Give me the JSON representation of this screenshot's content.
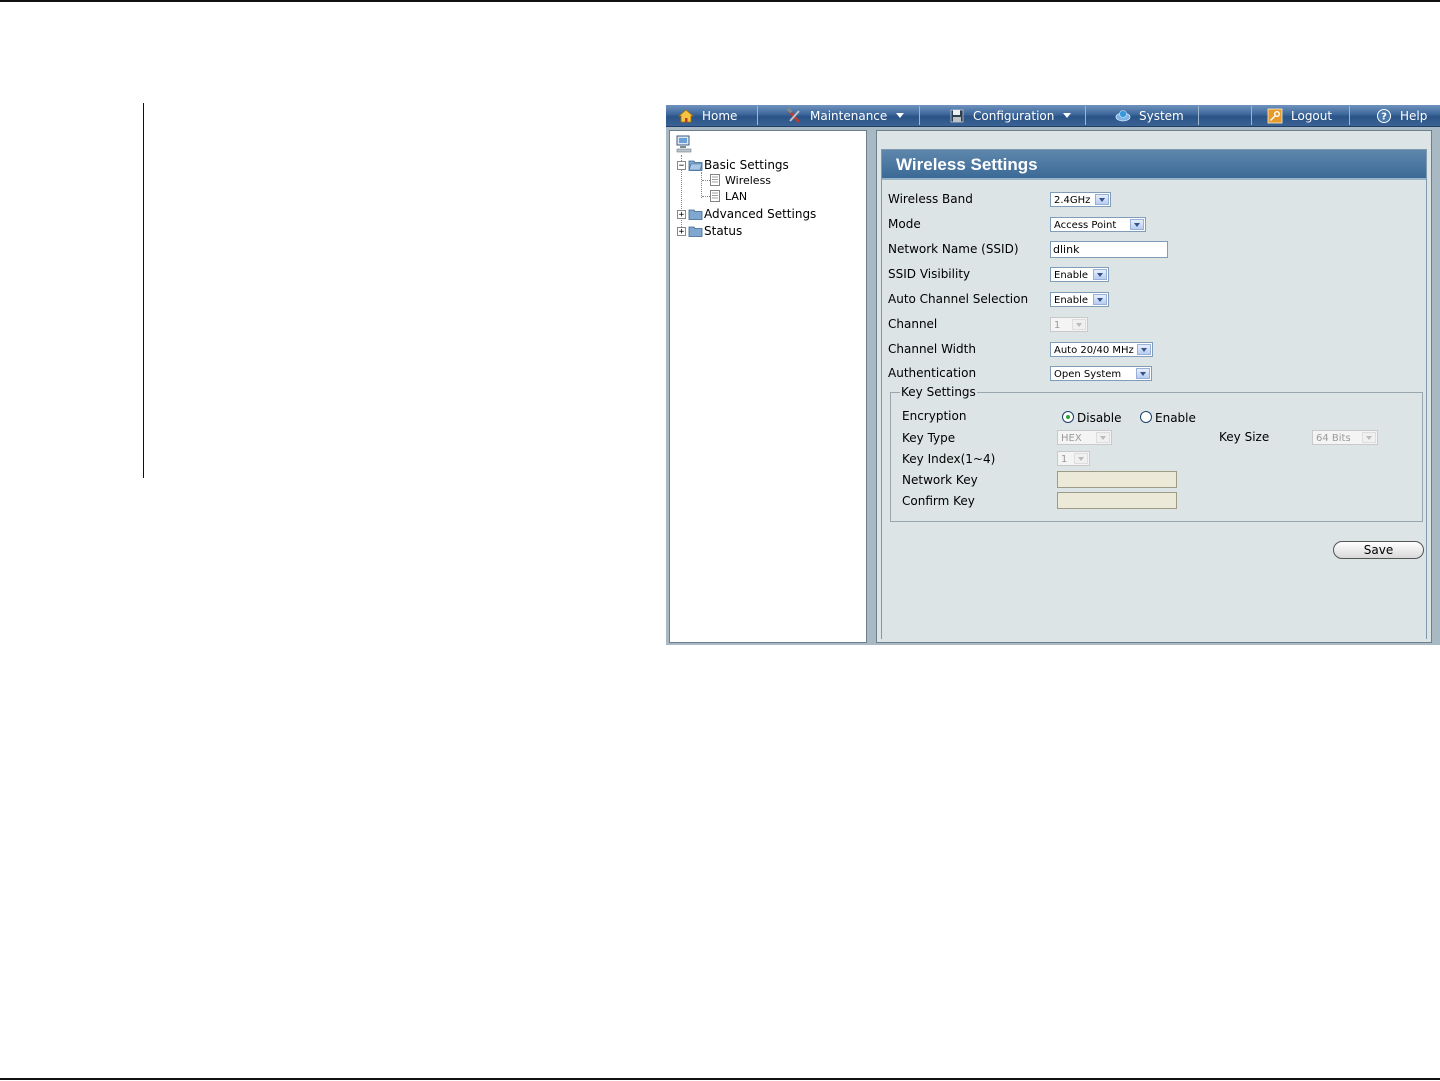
{
  "nav": {
    "home": "Home",
    "maintenance": "Maintenance",
    "configuration": "Configuration",
    "system": "System",
    "logout": "Logout",
    "help": "Help"
  },
  "tree": {
    "basic_settings": "Basic Settings",
    "wireless": "Wireless",
    "lan": "LAN",
    "advanced_settings": "Advanced Settings",
    "status": "Status"
  },
  "panel": {
    "title": "Wireless Settings"
  },
  "form": {
    "wireless_band": {
      "label": "Wireless Band",
      "value": "2.4GHz"
    },
    "mode": {
      "label": "Mode",
      "value": "Access Point"
    },
    "ssid": {
      "label": "Network Name (SSID)",
      "value": "dlink"
    },
    "ssid_visibility": {
      "label": "SSID Visibility",
      "value": "Enable"
    },
    "auto_channel": {
      "label": "Auto Channel Selection",
      "value": "Enable"
    },
    "channel": {
      "label": "Channel",
      "value": "1"
    },
    "channel_width": {
      "label": "Channel Width",
      "value": "Auto 20/40 MHz"
    },
    "authentication": {
      "label": "Authentication",
      "value": "Open System"
    }
  },
  "key_settings": {
    "legend": "Key Settings",
    "encryption_label": "Encryption",
    "disable_label": "Disable",
    "enable_label": "Enable",
    "encryption_selected": "Disable",
    "key_type_label": "Key Type",
    "key_type_value": "HEX",
    "key_size_label": "Key Size",
    "key_size_value": "64 Bits",
    "key_index_label": "Key Index(1~4)",
    "key_index_value": "1",
    "network_key_label": "Network Key",
    "confirm_key_label": "Confirm Key"
  },
  "actions": {
    "save": "Save"
  },
  "colors": {
    "nav_bar": "#3d679b",
    "panel_title": "#3b6a96",
    "content_bg": "#dce4e6",
    "frame_bg": "#a9b9c3"
  }
}
